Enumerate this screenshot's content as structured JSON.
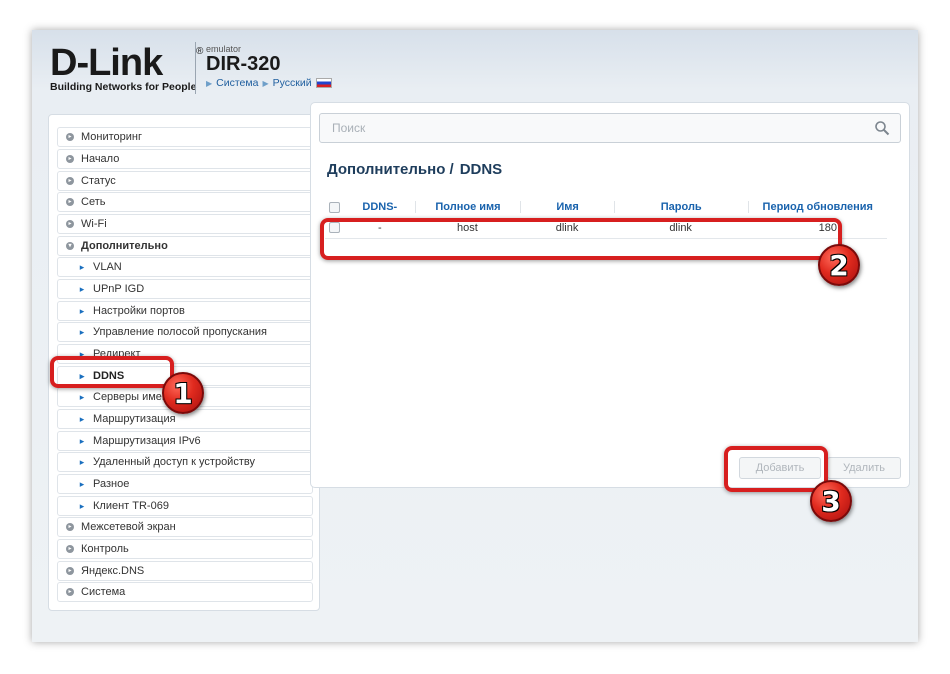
{
  "header": {
    "brand": "D-Link",
    "reg": "®",
    "tagline": "Building Networks for People",
    "emulator": "emulator",
    "model": "DIR-320",
    "link_system": "Система",
    "link_language": "Русский"
  },
  "sidebar": {
    "items": [
      {
        "label": "Мониторинг"
      },
      {
        "label": "Начало"
      },
      {
        "label": "Статус"
      },
      {
        "label": "Сеть"
      },
      {
        "label": "Wi-Fi"
      },
      {
        "label": "Дополнительно"
      },
      {
        "label": "VLAN"
      },
      {
        "label": "UPnP IGD"
      },
      {
        "label": "Настройки портов"
      },
      {
        "label": "Управление полосой пропускания"
      },
      {
        "label": "Редирект"
      },
      {
        "label": "DDNS"
      },
      {
        "label": "Серверы имен"
      },
      {
        "label": "Маршрутизация"
      },
      {
        "label": "Маршрутизация IPv6"
      },
      {
        "label": "Удаленный доступ к устройству"
      },
      {
        "label": "Разное"
      },
      {
        "label": "Клиент TR-069"
      },
      {
        "label": "Межсетевой экран"
      },
      {
        "label": "Контроль"
      },
      {
        "label": "Яндекс.DNS"
      },
      {
        "label": "Система"
      }
    ]
  },
  "main": {
    "search_placeholder": "Поиск",
    "breadcrumb_parent": "Дополнительно /",
    "breadcrumb_current": "DDNS",
    "table": {
      "headers": [
        "DDNS-",
        "Полное имя",
        "Имя",
        "Пароль",
        "Период обновления"
      ],
      "rows": [
        [
          "-",
          "host",
          "dlink",
          "dlink",
          "180"
        ]
      ]
    },
    "add_button": "Добавить",
    "delete_button": "Удалить"
  },
  "annotations": {
    "badge1": "1",
    "badge2": "2",
    "badge3": "3",
    "color": "#d71f1f"
  }
}
